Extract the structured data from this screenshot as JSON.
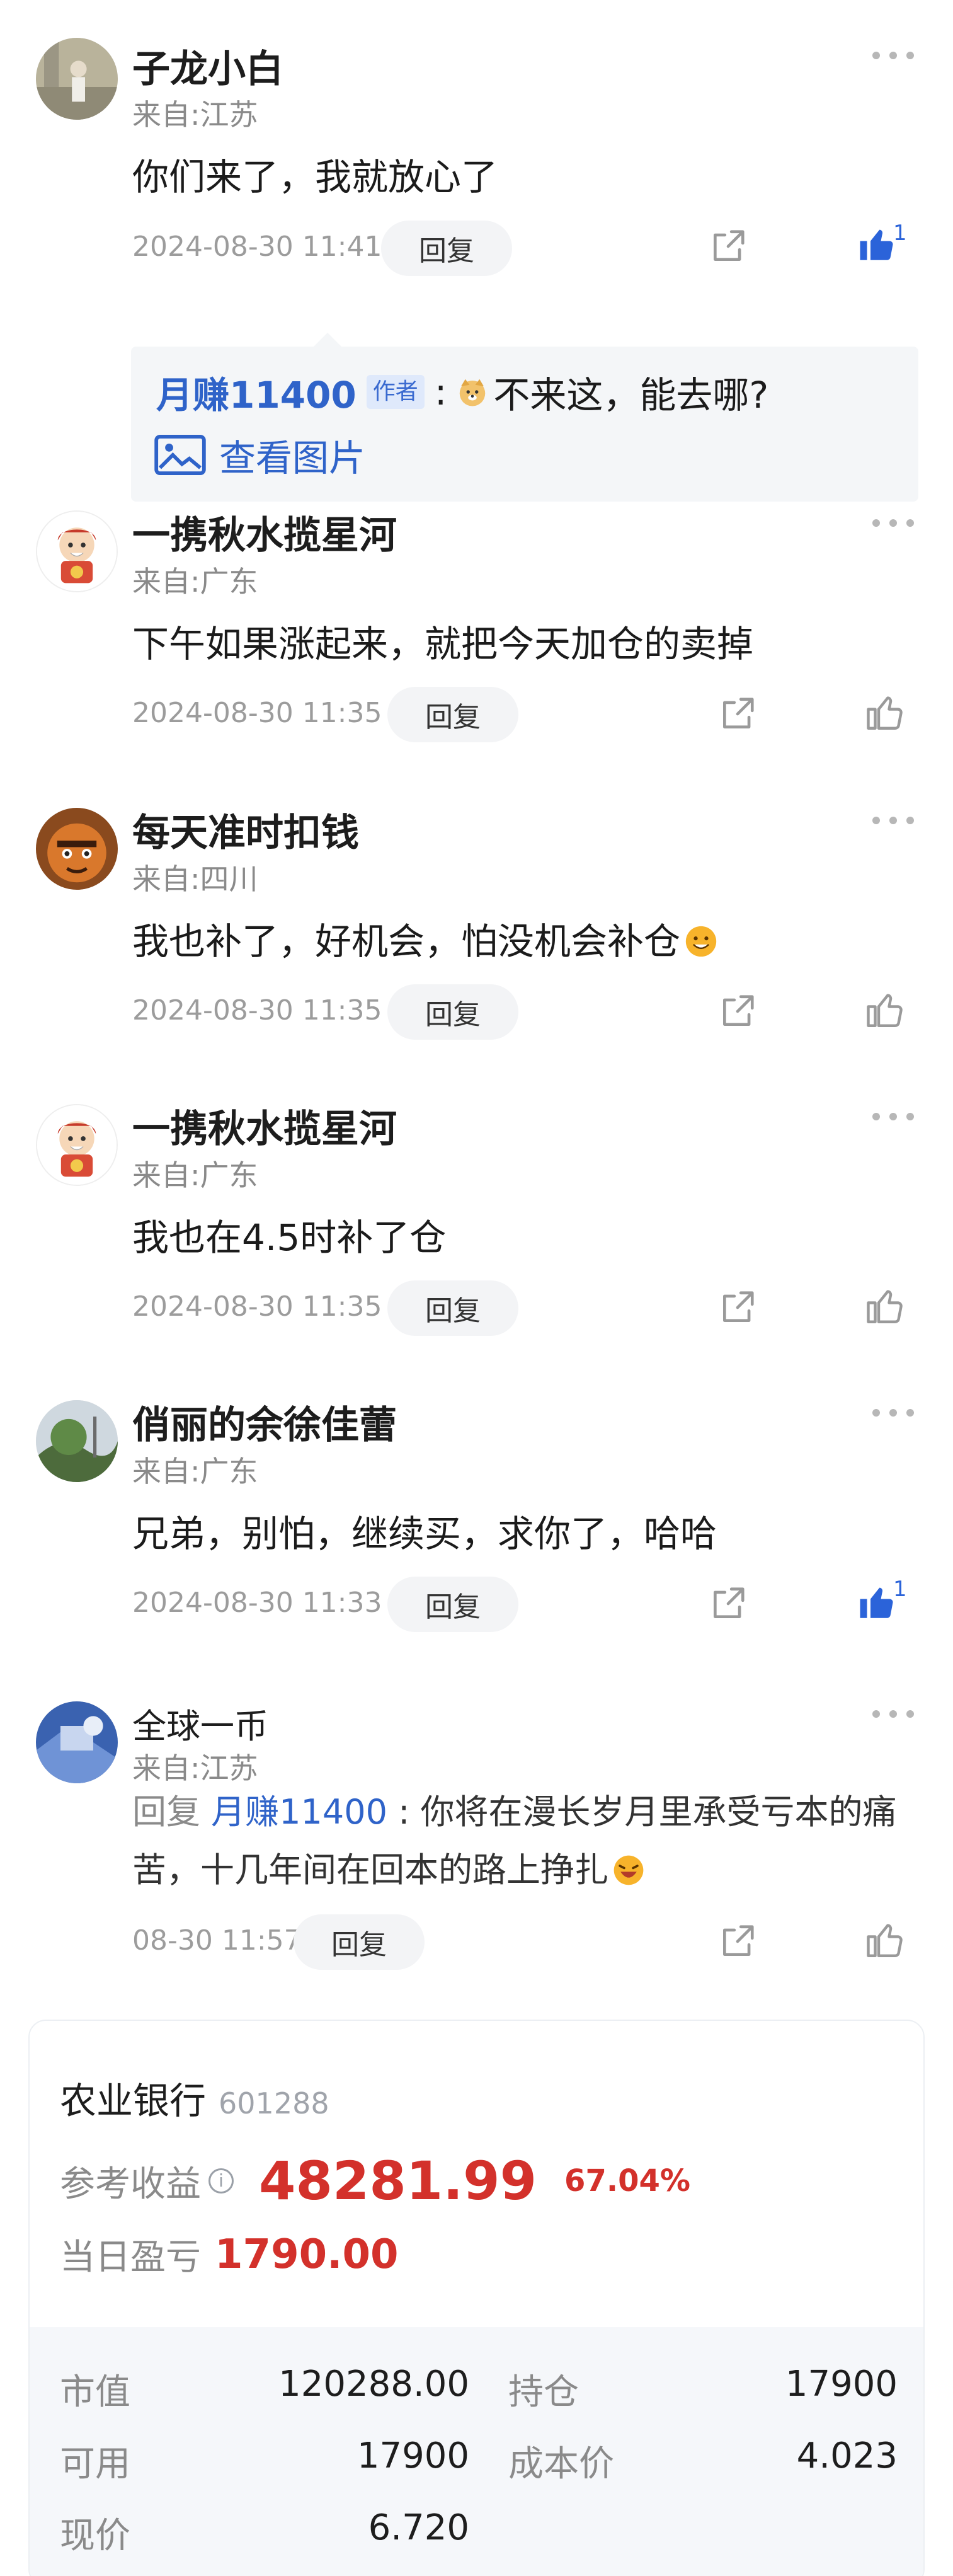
{
  "comments": [
    {
      "name": "子龙小白",
      "location": "来自:江苏",
      "text": "你们来了，我就放心了",
      "time": "2024-08-30 11:41",
      "reply": "回复",
      "likes": "1",
      "quote": {
        "author": "月赚11400",
        "tag": "作者",
        "colon": ":",
        "text": "不来这，能去哪?",
        "image_link": "查看图片"
      }
    },
    {
      "name": "一携秋水揽星河",
      "location": "来自:广东",
      "text": "下午如果涨起来，就把今天加仓的卖掉",
      "time": "2024-08-30 11:35",
      "reply": "回复"
    },
    {
      "name": "每天准时扣钱",
      "location": "来自:四川",
      "text": "我也补了，好机会，怕没机会补仓",
      "time": "2024-08-30 11:35",
      "reply": "回复"
    },
    {
      "name": "一携秋水揽星河",
      "location": "来自:广东",
      "text": "我也在4.5时补了仓",
      "time": "2024-08-30 11:35",
      "reply": "回复"
    },
    {
      "name": "俏丽的余徐佳蕾",
      "location": "来自:广东",
      "text": "兄弟，别怕，继续买，求你了，哈哈",
      "time": "2024-08-30 11:33",
      "reply": "回复",
      "likes": "1"
    },
    {
      "name": "全球一币",
      "location": "来自:江苏",
      "reply_prefix": "回复",
      "reply_to": "月赚11400",
      "reply_text_1": ": 你将在漫长岁月里承受亏本的痛",
      "reply_text_2": "苦，十几年间在回本的路上挣扎",
      "time": "08-30 11:57",
      "reply": "回复"
    }
  ],
  "position": {
    "stock_name": "农业银行",
    "stock_code": "601288",
    "ref_profit_label": "参考收益",
    "ref_profit": "48281.99",
    "ref_profit_pct": "67.04%",
    "day_pl_label": "当日盈亏",
    "day_pl": "1790.00",
    "market_value_label": "市值",
    "market_value": "120288.00",
    "holding_label": "持仓",
    "holding": "17900",
    "available_label": "可用",
    "available": "17900",
    "cost_label": "成本价",
    "cost": "4.023",
    "price_label": "现价",
    "price": "6.720",
    "positive_color": "#d3312b"
  },
  "colors": {
    "link": "#2f63c9",
    "like_active": "#2b63d9",
    "muted": "#8a8a8a"
  }
}
